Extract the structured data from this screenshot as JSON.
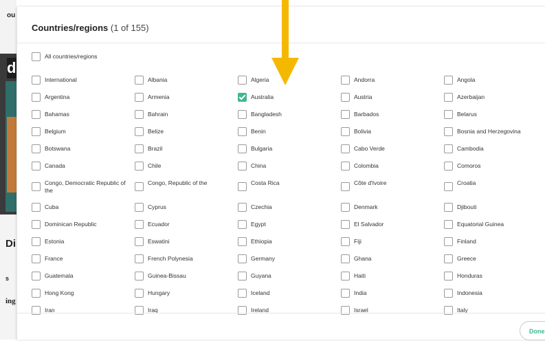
{
  "background_page": {
    "top_text": "ou",
    "left_text_1": "d",
    "left_text_2": "Di",
    "left_text_3": "s",
    "left_text_4": "ing"
  },
  "modal": {
    "title": "Countries/regions",
    "count": "(1 of 155)",
    "all_label": "All countries/regions",
    "done_label": "Done"
  },
  "countries": [
    [
      "International",
      "Albania",
      "Algeria",
      "Andorra",
      "Angola"
    ],
    [
      "Argentina",
      "Armenia",
      "Australia",
      "Austria",
      "Azerbaijan"
    ],
    [
      "Bahamas",
      "Bahrain",
      "Bangladesh",
      "Barbados",
      "Belarus"
    ],
    [
      "Belgium",
      "Belize",
      "Benin",
      "Bolivia",
      "Bosnia and Herzegovina"
    ],
    [
      "Botswana",
      "Brazil",
      "Bulgaria",
      "Cabo Verde",
      "Cambodia"
    ],
    [
      "Canada",
      "Chile",
      "China",
      "Colombia",
      "Comoros"
    ],
    [
      "Congo, Democratic Republic of the",
      "Congo, Republic of the",
      "Costa Rica",
      "Côte d'Ivoire",
      "Croatia"
    ],
    [
      "Cuba",
      "Cyprus",
      "Czechia",
      "Denmark",
      "Djibouti"
    ],
    [
      "Dominican Republic",
      "Ecuador",
      "Egypt",
      "El Salvador",
      "Equatorial Guinea"
    ],
    [
      "Estonia",
      "Eswatini",
      "Ethiopia",
      "Fiji",
      "Finland"
    ],
    [
      "France",
      "French Polynesia",
      "Germany",
      "Ghana",
      "Greece"
    ],
    [
      "Guatemala",
      "Guinea-Bissau",
      "Guyana",
      "Haiti",
      "Honduras"
    ],
    [
      "Hong Kong",
      "Hungary",
      "Iceland",
      "India",
      "Indonesia"
    ],
    [
      "Iran",
      "Iraq",
      "Ireland",
      "Israel",
      "Italy"
    ]
  ],
  "checked": [
    "Australia"
  ],
  "colors": {
    "check": "#3fb88f",
    "arrow": "#f5b800"
  },
  "arrow_icon": "down-arrow-icon"
}
